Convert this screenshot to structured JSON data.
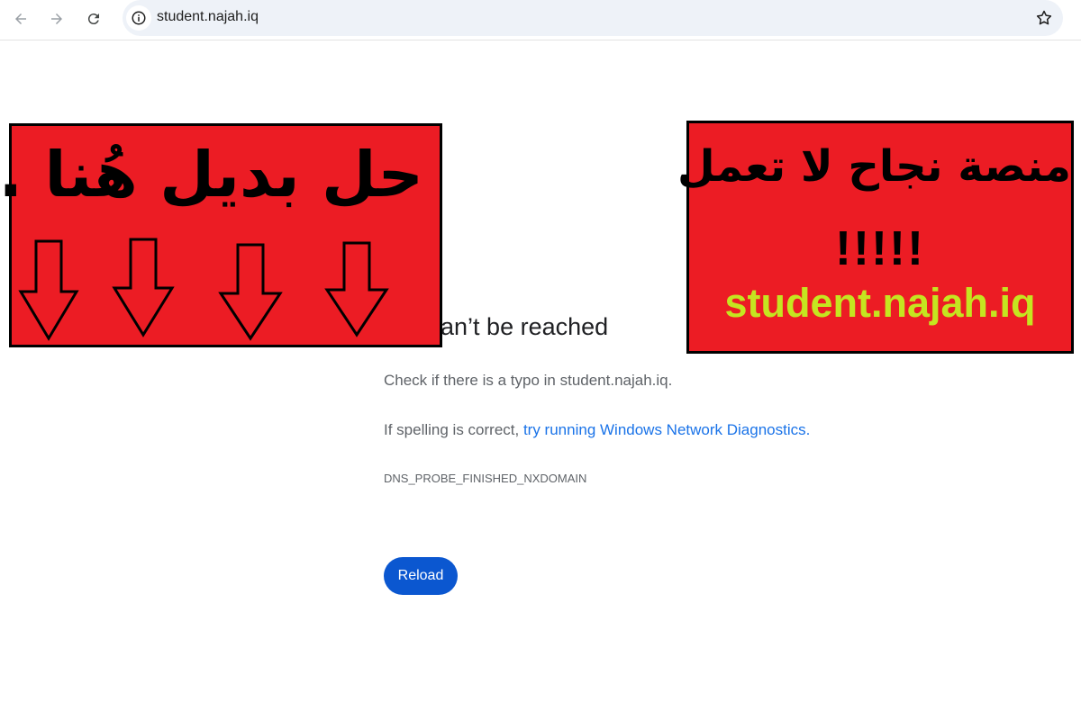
{
  "browser": {
    "url": "student.najah.iq"
  },
  "error_page": {
    "title": "site can’t be reached",
    "line1": "Check if there is a typo in student.najah.iq.",
    "line2_prefix": "If spelling is correct, ",
    "line2_link": "try running Windows Network Diagnostics.",
    "error_code": "DNS_PROBE_FINISHED_NXDOMAIN",
    "reload_label": "Reload"
  },
  "overlay": {
    "left_text": "حل بديل هُنا ..",
    "right_title": "منصة نجاح لا تعمل",
    "right_exclaim": "!!!!!",
    "right_url": "student.najah.iq"
  },
  "colors": {
    "banner_red": "#ec1c24",
    "url_green": "#c5e520",
    "link_blue": "#1a73e8",
    "reload_blue": "#0b57d0"
  },
  "icons": {
    "back": "arrow-left-icon",
    "forward": "arrow-right-icon",
    "reload": "refresh-icon",
    "info": "info-icon",
    "bookmark": "star-icon",
    "arrows": "down-arrow-icon"
  }
}
